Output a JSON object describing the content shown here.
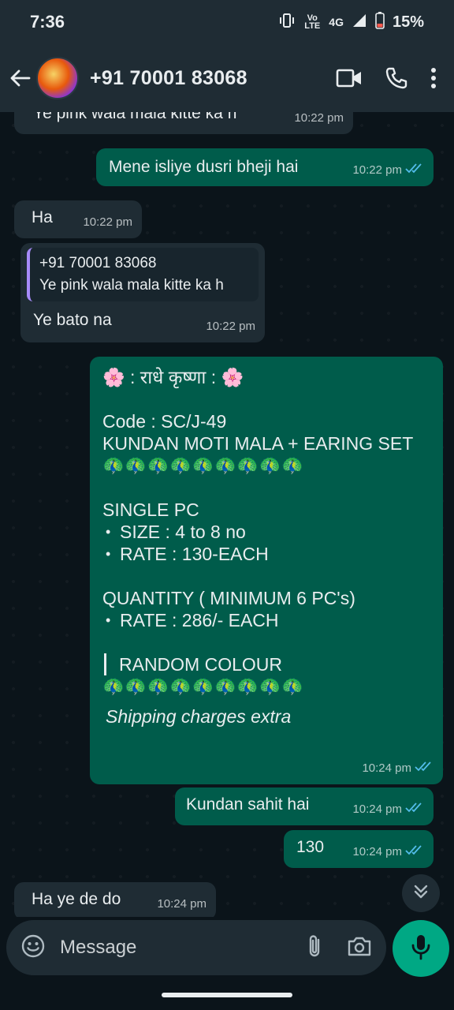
{
  "status": {
    "time": "7:36",
    "network": "4G",
    "volte": "Vo LTE",
    "battery": "15%"
  },
  "header": {
    "contact": "+91 70001 83068"
  },
  "messages": [
    {
      "text": "Ye pink wala mala kitte ka h",
      "time": "10:22 pm"
    },
    {
      "text": "Mene isliye dusri bheji hai",
      "time": "10:22 pm"
    },
    {
      "text": "Ha",
      "time": "10:22 pm"
    },
    {
      "quote_author": "+91 70001 83068",
      "quote_text": "Ye pink wala mala kitte ka h",
      "text": "Ye bato na",
      "time": "10:22 pm"
    },
    {
      "time": "10:24 pm",
      "title": "🌸 : राधे कृष्णा : 🌸",
      "code": "Code : SC/J-49",
      "product": "KUNDAN MOTI MALA + EARING SET",
      "peacocks": "🦚🦚🦚🦚🦚🦚🦚🦚🦚",
      "single_pc": "SINGLE PC",
      "size": "SIZE :  4 to 8 no",
      "rate_single": "RATE : 130-EACH",
      "quantity": "QUANTITY ( MINIMUM 6 PC's)",
      "rate_qty": "RATE : 286/- EACH",
      "colour": "RANDOM COLOUR",
      "peacocks2": "🦚🦚🦚🦚🦚🦚🦚🦚🦚",
      "shipping": "Shipping charges extra"
    },
    {
      "text": "Kundan sahit hai",
      "time": "10:24 pm"
    },
    {
      "text": "130",
      "time": "10:24 pm"
    },
    {
      "text": "Ha ye de do",
      "time": "10:24 pm"
    }
  ],
  "input": {
    "placeholder": "Message"
  },
  "icons": [
    "back-arrow-icon",
    "video-call-icon",
    "phone-icon",
    "more-icon",
    "emoji-icon",
    "attach-icon",
    "camera-icon",
    "mic-icon",
    "scroll-down-icon",
    "read-ticks-icon"
  ],
  "colors": {
    "outgoing": "#005c4b",
    "incoming": "#1f2c34",
    "accent": "#00a884",
    "ticks": "#53bdeb"
  }
}
